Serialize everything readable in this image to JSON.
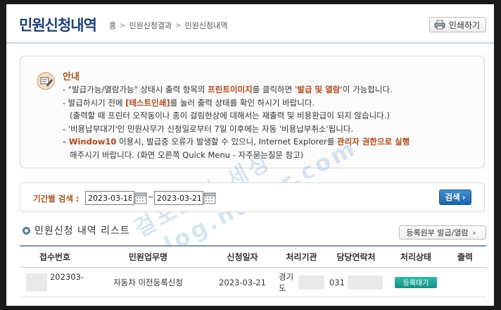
{
  "header": {
    "title": "민원신청내역",
    "breadcrumb": [
      "홈",
      "민원신청결과",
      "민원신청내역"
    ],
    "print_label": "인쇄하기"
  },
  "notice": {
    "title": "안내",
    "line1_a": "- \"발급가능/열람가능\" 상태시 출력 항목의 ",
    "line1_b": "프린트이미지",
    "line1_c": "를 클릭하면 ",
    "line1_d": "'발급 및 열람'",
    "line1_e": "이 가능합니다.",
    "line2_a": "- 발급하시기 전에 ",
    "line2_b": "[테스트인쇄]",
    "line2_c": "를 눌러 출력 상태를 확인 하시기 바랍니다.",
    "line3": "(출력할 때 프린터 오작동이나 종이 걸림현상에 대해서는 재출력 및 비용환급이 되지 않습니다.)",
    "line4": "- '비용납부대기'인 민원사무가 신청일로부터 7일 이후에는 자동 '비용납부취소'됩니다.",
    "line5_a": "- Window10",
    "line5_b": " 이용시, 발급중 오류가 발생할 수 있으니, Internet Explorer를 ",
    "line5_c": "관리자 권한으로 실행",
    "line6": "해주시기 바랍니다. (화면 오른쪽 Quick Menu - 자주묻는질문 참고)"
  },
  "search": {
    "label": "기간별 검색 :",
    "start_date": "2023-03-18",
    "tilde": "~",
    "end_date": "2023-03-21",
    "button_label": "검색"
  },
  "list": {
    "title": "민원신청 내역 리스트",
    "register_button": "등록원부 발급/열람",
    "columns": [
      "접수번호",
      "민원업무명",
      "신청일자",
      "처리기관",
      "담당연락처",
      "처리상태",
      "출력"
    ],
    "rows": [
      {
        "receipt_no": "202303-",
        "task_name": "자동차 이전등록신청",
        "date": "2023-03-21",
        "agency": "경기도",
        "contact": "031",
        "status": "등록대기"
      }
    ]
  },
  "watermark": "걸포스의 세상 blog.naver.com",
  "colors": {
    "title": "#1d3f7a",
    "highlight": "#b0461a",
    "search_button": "#1e64a8",
    "status_button": "#149083"
  }
}
